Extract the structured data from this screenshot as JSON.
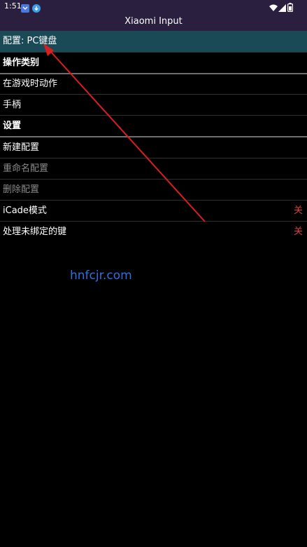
{
  "status_bar": {
    "time": "1:51",
    "left_icons": [
      "app-notification-icon",
      "download-icon"
    ],
    "right_icons": [
      "wifi-icon",
      "signal-icon",
      "battery-icon"
    ]
  },
  "app": {
    "title": "Xiaomi Input",
    "header_color": "#2a1f3f",
    "selected_color": "#1b4a57",
    "value_color": "#e03b3b"
  },
  "config_row": {
    "label": "配置: PC键盘"
  },
  "sections": {
    "action_category": "操作类别",
    "settings": "设置"
  },
  "items": {
    "in_game_action": "在游戏时动作",
    "gamepad": "手柄",
    "new_config": "新建配置",
    "rename_config": "重命名配置",
    "delete_config": "删除配置",
    "icade_mode": {
      "label": "iCade模式",
      "value": "关"
    },
    "handle_unbound": {
      "label": "处理未绑定的键",
      "value": "关"
    }
  },
  "watermark": "hnfcjr.com",
  "annotation": {
    "type": "red-arrow",
    "color": "#d81f1f"
  }
}
